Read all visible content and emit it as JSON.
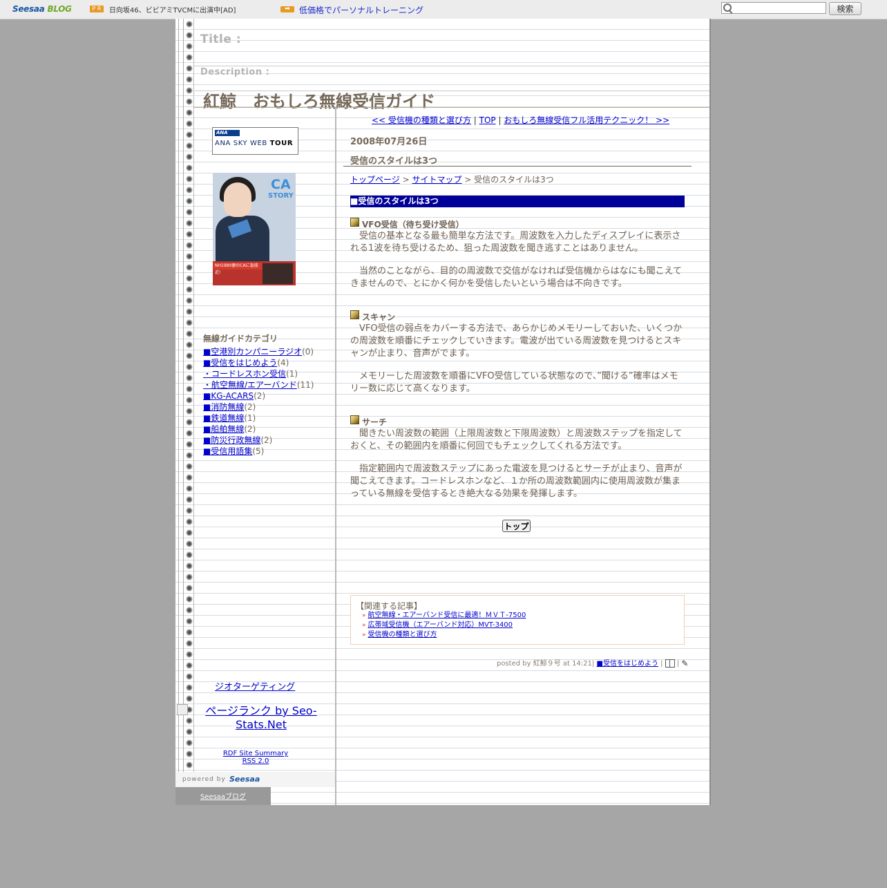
{
  "topbar": {
    "logo_seesaa": "Seesaa",
    "logo_blog": "BLOG",
    "pr_badge": "P R",
    "pr_text": "日向坂46、ビビアミTVCMに出演中[AD]",
    "arrow_badge": "➡",
    "ad_link": "低価格でパーソナルトレーニング",
    "search_value": "",
    "search_button": "検索"
  },
  "header": {
    "title_label": "Title :",
    "description_label": "Description :",
    "blog_title": "紅鯨　おもしろ無線受信ガイド"
  },
  "sidebar": {
    "ana_logo_main": "ANA",
    "ana_banner_text_1": "ANA SKY WEB ",
    "ana_banner_text_2": "TOUR",
    "book_title_ca": "CA",
    "book_title_story": "STORY",
    "book_red_text": "NH1980便のCAに急接近!",
    "category_heading": "無線ガイドカテゴリ",
    "categories": [
      {
        "label": "■空港別カンパニーラジオ",
        "count": "(0)"
      },
      {
        "label": "■受信をはじめよう",
        "count": "(4)"
      },
      {
        "label": "・コードレスホン受信",
        "count": "(1)"
      },
      {
        "label": "・航空無線/エアーバンド",
        "count": "(11)"
      },
      {
        "label": "■KG-ACARS",
        "count": "(2)"
      },
      {
        "label": "■消防無線",
        "count": "(2)"
      },
      {
        "label": "■鉄道無線",
        "count": "(1)"
      },
      {
        "label": "■船舶無線",
        "count": "(2)"
      },
      {
        "label": "■防災行政無線",
        "count": "(2)"
      },
      {
        "label": "■受信用語集",
        "count": "(5)"
      }
    ],
    "geo_link": "ジオターゲティング",
    "pagerank_link": "ページランク by Seo-Stats.Net",
    "rdf_link": "RDF Site Summary",
    "rss_link": "RSS 2.0",
    "powered_text": "powered by",
    "powered_logo": "Seesaa",
    "footer_link": "Seesaaブログ"
  },
  "nav": {
    "prev_label": "<< 受信機の種類と選び方",
    "sep1": " | ",
    "top_label": "TOP",
    "sep2": " | ",
    "next_label": "おもしろ無線受信フル活用テクニック！ >>"
  },
  "post": {
    "date": "2008年07月26日",
    "title": "受信のスタイルは3つ",
    "breadcrumb_home": "トップページ",
    "breadcrumb_sep1": " > ",
    "breadcrumb_sitemap": "サイトマップ",
    "breadcrumb_current": " > 受信のスタイルは3つ",
    "section_bar": "■受信のスタイルは3つ",
    "sections": [
      {
        "heading": "VFO受信（待ち受け受信）",
        "paragraphs": [
          "　受信の基本となる最も簡単な方法です。周波数を入力したディスプレイに表示される1波を待ち受けるため、狙った周波数を聞き逃すことはありません。",
          "　当然のことながら、目的の周波数で交信がなければ受信機からはなにも聞こえてきませんので、とにかく何かを受信したいという場合は不向きです。"
        ]
      },
      {
        "heading": "スキャン",
        "paragraphs": [
          "　VFO受信の弱点をカバーする方法で、あらかじめメモリーしておいた、いくつかの周波数を順番にチェックしていきます。電波が出ている周波数を見つけるとスキャンが止まり、音声がでます。",
          "　メモリーした周波数を順番にVFO受信している状態なので、”聞ける”確率はメモリー数に応じて高くなります。"
        ]
      },
      {
        "heading": "サーチ",
        "paragraphs": [
          "　聞きたい周波数の範囲（上限周波数と下限周波数）と周波数ステップを指定しておくと、その範囲内を順番に何回でもチェックしてくれる方法です。",
          "　指定範囲内で周波数ステップにあった電波を見つけるとサーチが止まり、音声が聞こえてきます。コードレスホンなど、１か所の周波数範囲内に使用周波数が集まっている無線を受信するとき絶大なる効果を発揮します。"
        ]
      }
    ],
    "top_button": "トップ",
    "related_title": "【関連する記事】",
    "related": [
      "航空無線・エアーバンド受信に最適！ＭＶＴ-7500",
      "広帯域受信機（エアーバンド対応）MVT-3400",
      "受信機の種類と選び方"
    ],
    "posted_by": "posted by 紅鯨９号 at 14:21| ",
    "posted_category": "■受信をはじめよう",
    "posted_sep1": " | ",
    "posted_sep2": " | "
  }
}
